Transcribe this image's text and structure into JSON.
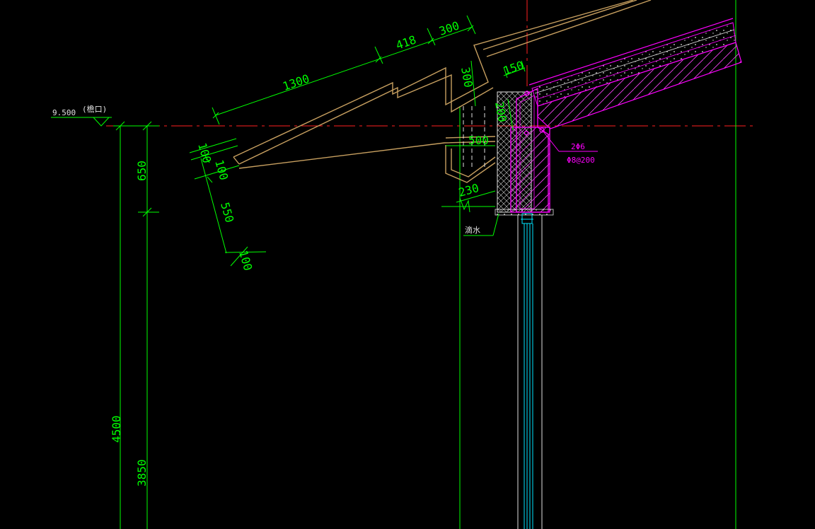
{
  "colors": {
    "background": "#000000",
    "dimension": "#00ff00",
    "structure": "#c8a060",
    "section": "#ff00ff",
    "axis": "#ff2020",
    "glass": "#00e5ff",
    "outline": "#e0e0e0"
  },
  "elevation": {
    "value": "9.500",
    "label": "(檐口)"
  },
  "dimensions": {
    "d1300": "1300",
    "d418": "418",
    "d300_top": "300",
    "d300_side": "300",
    "d150": "150",
    "d200": "200",
    "d500": "500",
    "d230": "230",
    "d100_a": "100",
    "d100_b": "100",
    "d550": "550",
    "d100_c": "100",
    "d650": "650",
    "d4500": "4500",
    "d3850": "3850"
  },
  "rebar": {
    "line1": "2Φ6",
    "line2": "Φ8@200"
  },
  "drip_label": "滴水"
}
